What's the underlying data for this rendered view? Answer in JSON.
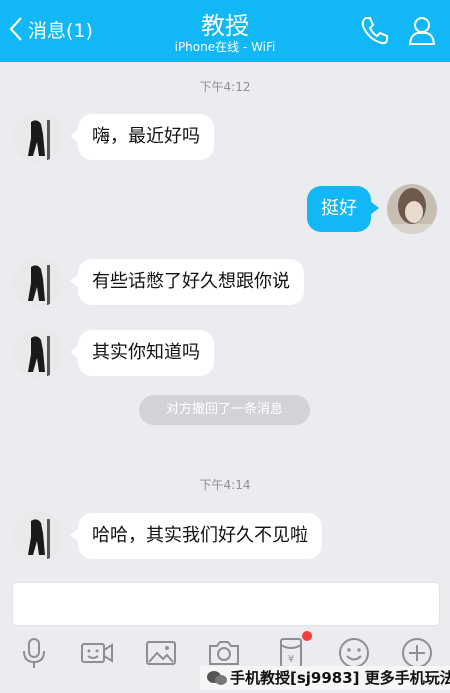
{
  "header": {
    "back_label": "消息(1)",
    "title": "教授",
    "subtitle": "iPhone在线 - WiFi"
  },
  "messages": {
    "time1": "下午4:12",
    "msg1": "嗨，最近好吗",
    "msg2": "挺好",
    "msg3": "有些话憋了好久想跟你说",
    "msg4": "其实你知道吗",
    "system": "对方撤回了一条消息",
    "time2": "下午4:14",
    "msg5": "哈哈，其实我们好久不见啦"
  },
  "input": {
    "placeholder": ""
  },
  "toolbar": {
    "icons": [
      "microphone-icon",
      "video-icon",
      "image-icon",
      "camera-icon",
      "red-packet-icon",
      "emoji-icon",
      "plus-icon"
    ]
  },
  "watermark": {
    "text": "手机教授[sj9983] 更多手机玩法"
  },
  "colors": {
    "accent": "#12b7f5",
    "background": "#ebecf0",
    "badge": "#fa3b3b"
  }
}
